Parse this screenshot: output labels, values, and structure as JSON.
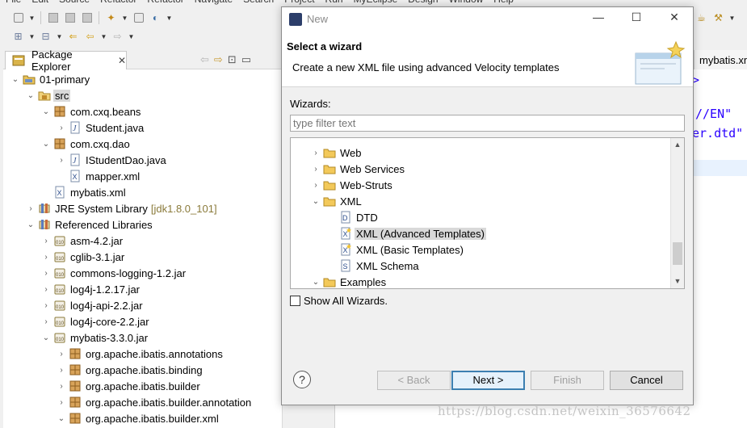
{
  "ide": {
    "menu": [
      "File",
      "Edit",
      "Source",
      "Refactor",
      "Refactor",
      "Navigate",
      "Search",
      "Project",
      "Run",
      "MyEclipse",
      "Design",
      "Window",
      "Help"
    ],
    "explorer": {
      "tab_label": "Package Explorer",
      "tree": [
        {
          "label": "01-primary",
          "icon": "project-icon",
          "twisty": "open",
          "depth": 0
        },
        {
          "label": "src",
          "icon": "source-folder-icon",
          "twisty": "open",
          "depth": 1,
          "selected": true
        },
        {
          "label": "com.cxq.beans",
          "icon": "package-icon",
          "twisty": "open",
          "depth": 2
        },
        {
          "label": "Student.java",
          "icon": "java-file-icon",
          "twisty": "closed",
          "depth": 3
        },
        {
          "label": "com.cxq.dao",
          "icon": "package-icon",
          "twisty": "open",
          "depth": 2
        },
        {
          "label": "IStudentDao.java",
          "icon": "java-file-icon",
          "twisty": "closed",
          "depth": 3
        },
        {
          "label": "mapper.xml",
          "icon": "xml-file-icon",
          "twisty": "none",
          "depth": 3
        },
        {
          "label": "mybatis.xml",
          "icon": "xml-file-icon",
          "twisty": "none",
          "depth": 2
        },
        {
          "label": "JRE System Library",
          "suffix": "[jdk1.8.0_101]",
          "icon": "library-icon",
          "twisty": "closed",
          "depth": 1
        },
        {
          "label": "Referenced Libraries",
          "icon": "library-icon",
          "twisty": "open",
          "depth": 1
        },
        {
          "label": "asm-4.2.jar",
          "icon": "jar-icon",
          "twisty": "closed",
          "depth": 2
        },
        {
          "label": "cglib-3.1.jar",
          "icon": "jar-icon",
          "twisty": "closed",
          "depth": 2
        },
        {
          "label": "commons-logging-1.2.jar",
          "icon": "jar-icon",
          "twisty": "closed",
          "depth": 2
        },
        {
          "label": "log4j-1.2.17.jar",
          "icon": "jar-icon",
          "twisty": "closed",
          "depth": 2
        },
        {
          "label": "log4j-api-2.2.jar",
          "icon": "jar-icon",
          "twisty": "closed",
          "depth": 2
        },
        {
          "label": "log4j-core-2.2.jar",
          "icon": "jar-icon",
          "twisty": "closed",
          "depth": 2
        },
        {
          "label": "mybatis-3.3.0.jar",
          "icon": "jar-icon",
          "twisty": "open",
          "depth": 2
        },
        {
          "label": "org.apache.ibatis.annotations",
          "icon": "package-icon",
          "twisty": "closed",
          "depth": 3
        },
        {
          "label": "org.apache.ibatis.binding",
          "icon": "package-icon",
          "twisty": "closed",
          "depth": 3
        },
        {
          "label": "org.apache.ibatis.builder",
          "icon": "package-icon",
          "twisty": "closed",
          "depth": 3
        },
        {
          "label": "org.apache.ibatis.builder.annotation",
          "icon": "package-icon",
          "twisty": "closed",
          "depth": 3
        },
        {
          "label": "org.apache.ibatis.builder.xml",
          "icon": "package-icon",
          "twisty": "open",
          "depth": 3
        }
      ]
    },
    "editor": {
      "tab_label": "mybatis.xm",
      "code_lines": [
        ">",
        "//EN\"",
        "er.dtd\""
      ]
    }
  },
  "dialog": {
    "title": "New",
    "header_title": "Select a wizard",
    "header_desc": "Create a new XML file using advanced Velocity templates",
    "wizards_label": "Wizards:",
    "filter_placeholder": "type filter text",
    "tree": [
      {
        "label": "Web",
        "icon": "folder-icon",
        "twisty": "closed",
        "depth": 1
      },
      {
        "label": "Web Services",
        "icon": "folder-icon",
        "twisty": "closed",
        "depth": 1
      },
      {
        "label": "Web-Struts",
        "icon": "folder-icon",
        "twisty": "closed",
        "depth": 1
      },
      {
        "label": "XML",
        "icon": "folder-icon",
        "twisty": "open",
        "depth": 1
      },
      {
        "label": "DTD",
        "icon": "dtd-icon",
        "twisty": "none",
        "depth": 2
      },
      {
        "label": "XML (Advanced Templates)",
        "icon": "xml-wizard-icon",
        "twisty": "none",
        "depth": 2,
        "selected": true
      },
      {
        "label": "XML (Basic Templates)",
        "icon": "xml-wizard-icon",
        "twisty": "none",
        "depth": 2
      },
      {
        "label": "XML Schema",
        "icon": "schema-icon",
        "twisty": "none",
        "depth": 2
      },
      {
        "label": "Examples",
        "icon": "folder-icon",
        "twisty": "open",
        "depth": 1
      }
    ],
    "show_all_label": "Show All Wizards.",
    "show_all_checked": false,
    "buttons": {
      "back": "< Back",
      "next": "Next >",
      "finish": "Finish",
      "cancel": "Cancel"
    }
  },
  "watermark": "https://blog.csdn.net/weixin_36576642"
}
